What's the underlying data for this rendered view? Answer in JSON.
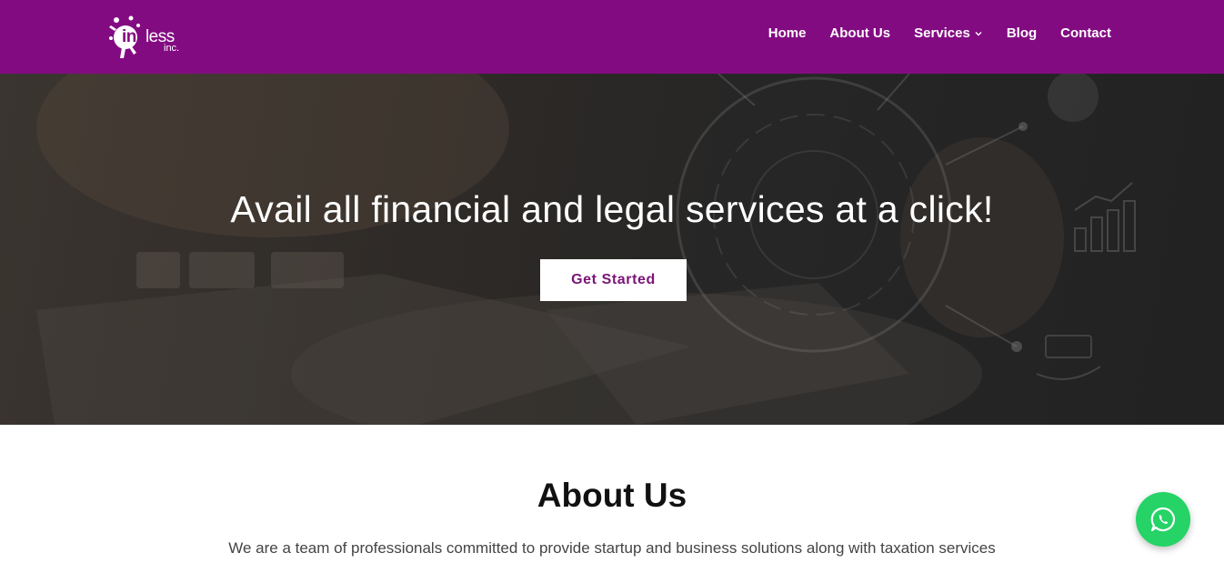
{
  "brand": {
    "logo_word_ink": "ink",
    "logo_word_less": "less",
    "logo_sub": "inc.",
    "header_color": "#830b82",
    "accent_color": "#7a1477"
  },
  "nav": {
    "items": [
      {
        "label": "Home"
      },
      {
        "label": "About Us"
      },
      {
        "label": "Services",
        "icon": "chevron-down-icon"
      },
      {
        "label": "Blog"
      },
      {
        "label": "Contact"
      }
    ]
  },
  "hero": {
    "title": "Avail all financial and legal services at a click!",
    "cta_label": "Get Started"
  },
  "about": {
    "title": "About Us",
    "text": "We are a team of professionals committed to provide startup and business solutions along with taxation services"
  },
  "floating": {
    "whatsapp_icon": "whatsapp-icon",
    "whatsapp_color": "#25d366"
  }
}
